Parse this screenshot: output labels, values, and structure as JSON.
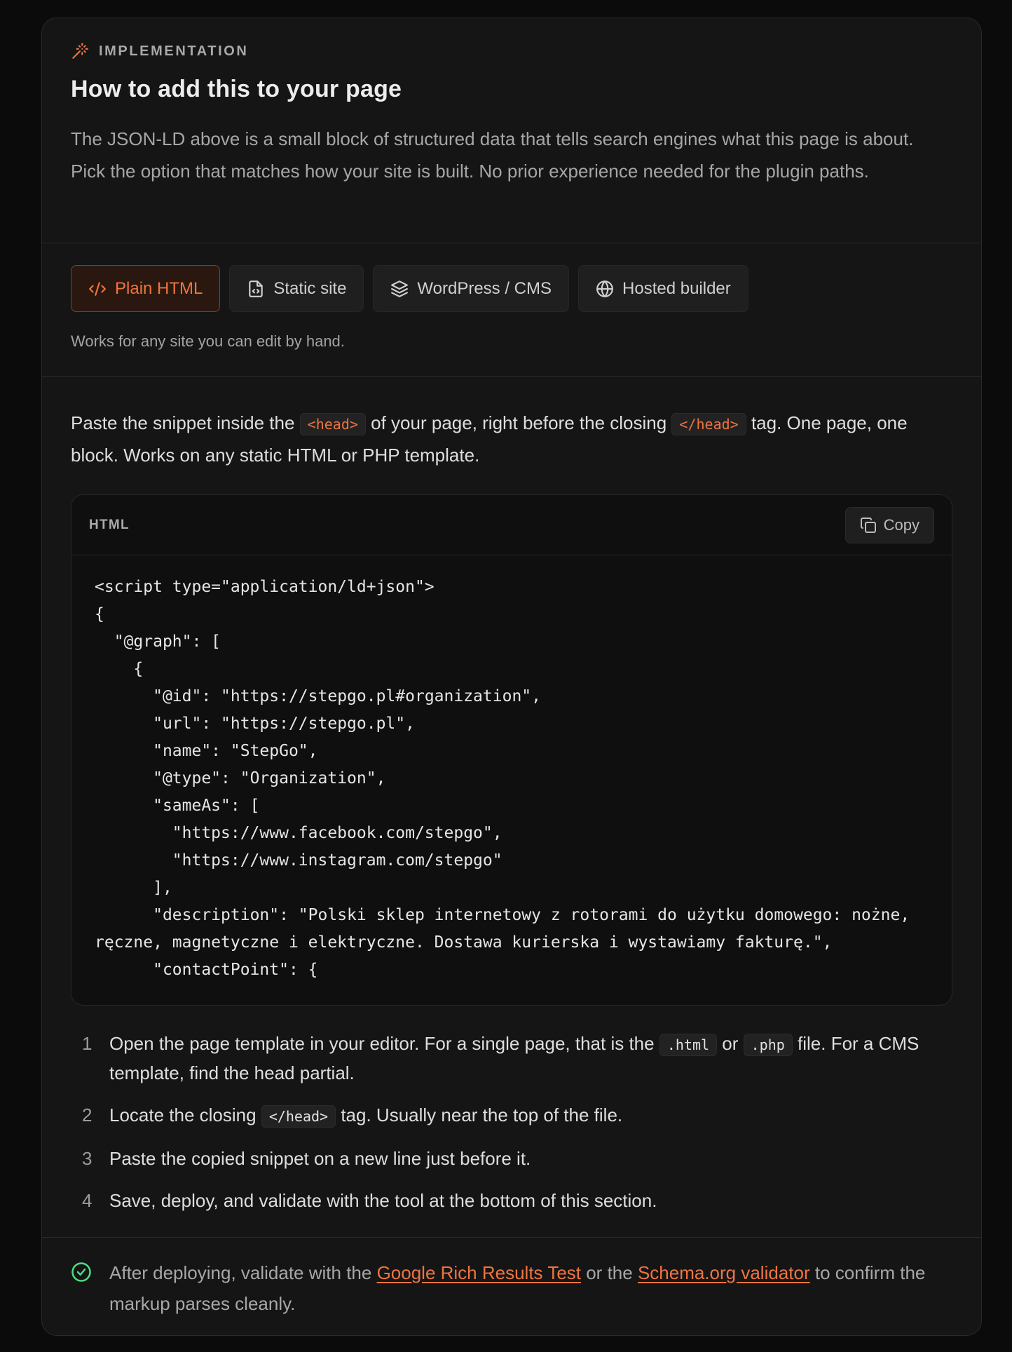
{
  "header": {
    "eyebrow": "IMPLEMENTATION",
    "eyebrow_icon": "magic-wand-icon",
    "title": "How to add this to your page",
    "intro": "The JSON-LD above is a small block of structured data that tells search engines what this page is about. Pick the option that matches how your site is built. No prior experience needed for the plugin paths."
  },
  "tabs": {
    "items": [
      {
        "label": "Plain HTML",
        "icon": "code-icon",
        "active": true
      },
      {
        "label": "Static site",
        "icon": "file-code-icon",
        "active": false
      },
      {
        "label": "WordPress / CMS",
        "icon": "layers-icon",
        "active": false
      },
      {
        "label": "Hosted builder",
        "icon": "globe-icon",
        "active": false
      }
    ],
    "note": "Works for any site you can edit by hand."
  },
  "instructions": {
    "part1": "Paste the snippet inside the ",
    "code1": "<head>",
    "part2": " of your page, right before the closing ",
    "code2": "</head>",
    "part3": " tag. One page, one block. Works on any static HTML or PHP template."
  },
  "code_block": {
    "language": "HTML",
    "copy_label": "Copy",
    "content": "<script type=\"application/ld+json\">\n{\n  \"@graph\": [\n    {\n      \"@id\": \"https://stepgo.pl#organization\",\n      \"url\": \"https://stepgo.pl\",\n      \"name\": \"StepGo\",\n      \"@type\": \"Organization\",\n      \"sameAs\": [\n        \"https://www.facebook.com/stepgo\",\n        \"https://www.instagram.com/stepgo\"\n      ],\n      \"description\": \"Polski sklep internetowy z rotorami do użytku domowego: nożne, ręczne, magnetyczne i elektryczne. Dostawa kurierska i wystawiamy fakturę.\",\n      \"contactPoint\": {"
  },
  "steps": [
    {
      "num": "1",
      "a": "Open the page template in your editor. For a single page, that is the ",
      "c1": ".html",
      "b": " or ",
      "c2": ".php",
      "c": " file. For a CMS template, find the head partial."
    },
    {
      "num": "2",
      "a": "Locate the closing ",
      "c1": "</head>",
      "b": " tag. Usually near the top of the file."
    },
    {
      "num": "3",
      "text": "Paste the copied snippet on a new line just before it."
    },
    {
      "num": "4",
      "text": "Save, deploy, and validate with the tool at the bottom of this section."
    }
  ],
  "footer": {
    "icon": "check-circle-icon",
    "before": "After deploying, validate with the ",
    "link1": "Google Rich Results Test",
    "middle": " or the ",
    "link2": "Schema.org validator",
    "after": " to confirm the markup parses cleanly."
  },
  "colors": {
    "accent": "#ef7440",
    "success": "#4ade80",
    "card_bg": "#151515",
    "page_bg": "#0b0b0b"
  }
}
